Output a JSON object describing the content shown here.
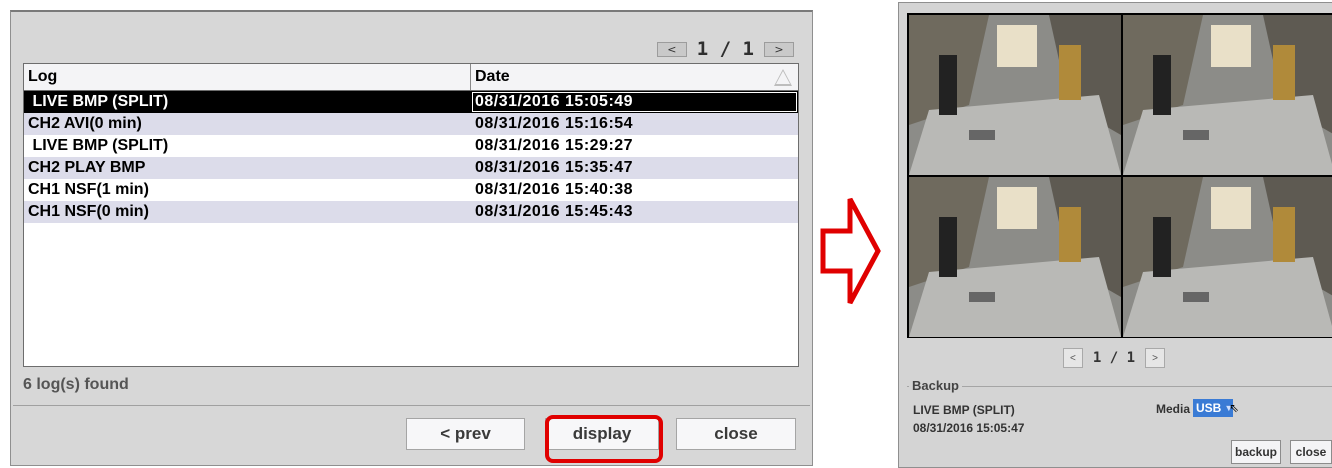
{
  "left_panel": {
    "pager": {
      "prev_icon": "<",
      "next_icon": ">",
      "text": "1 / 1"
    },
    "columns": {
      "log": "Log",
      "date": "Date"
    },
    "rows": [
      {
        "log": " LIVE BMP (SPLIT)",
        "date": "08/31/2016 15:05:49"
      },
      {
        "log": "CH2 AVI(0 min)",
        "date": "08/31/2016 15:16:54"
      },
      {
        "log": " LIVE BMP (SPLIT)",
        "date": "08/31/2016 15:29:27"
      },
      {
        "log": "CH2 PLAY BMP",
        "date": "08/31/2016 15:35:47"
      },
      {
        "log": "CH1 NSF(1 min)",
        "date": "08/31/2016 15:40:38"
      },
      {
        "log": "CH1 NSF(0 min)",
        "date": "08/31/2016 15:45:43"
      }
    ],
    "selected_row": 0,
    "found_text": "6 log(s) found",
    "buttons": {
      "prev": "< prev",
      "display": "display",
      "close": "close"
    }
  },
  "right_panel": {
    "pager": {
      "prev_icon": "<",
      "next_icon": ">",
      "text": "1 / 1"
    },
    "backup": {
      "legend": "Backup",
      "name": "LIVE BMP (SPLIT)",
      "date": "08/31/2016 15:05:47",
      "media_label": "Media",
      "media_value": "USB"
    },
    "buttons": {
      "backup": "backup",
      "close": "close"
    }
  },
  "colors": {
    "highlight": "#e00000",
    "arrow": "#e00000",
    "selected_row": "#000000",
    "alt_row": "#dcdcea",
    "media_select": "#3a7bd5"
  }
}
